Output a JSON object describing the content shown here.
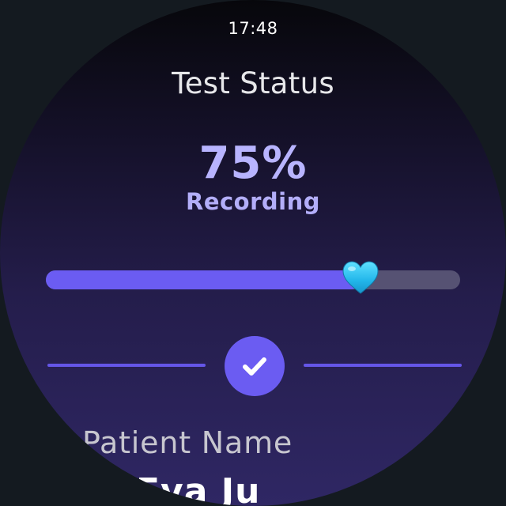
{
  "status_bar": {
    "time": "17:48"
  },
  "screen": {
    "title": "Test Status"
  },
  "progress": {
    "percent_label": "75%",
    "status_label": "Recording",
    "value": 0.76,
    "knob_icon": "heart-icon",
    "fill_color": "#6b5cf2",
    "track_color": "#565273",
    "knob_color": "#23b8ee"
  },
  "completion": {
    "icon": "check-icon",
    "color": "#6b5cf2"
  },
  "patient": {
    "label": "Patient Name",
    "name": "Eva Ju"
  }
}
